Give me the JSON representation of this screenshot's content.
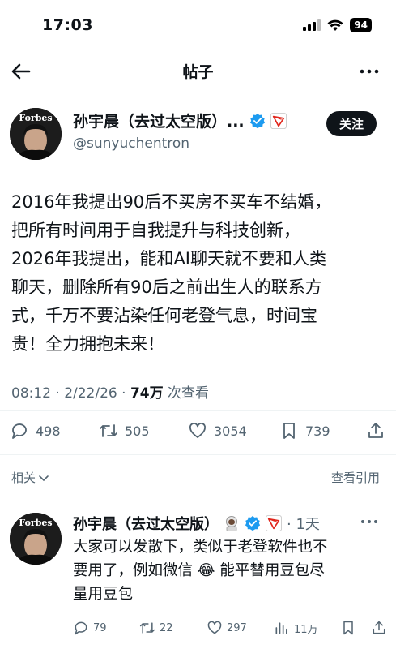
{
  "status": {
    "time": "17:03",
    "battery": "94"
  },
  "nav": {
    "title": "帖子"
  },
  "post": {
    "author_name": "孙宇晨（去过太空版）...",
    "handle": "@sunyuchentron",
    "follow_label": "关注",
    "avatar_text": "Forbes",
    "text_lines": [
      "2016年我提出90后不买房不买车不结婚，",
      "把所有时间用于自我提升与科技创新，",
      "2026年我提出，能和AI聊天就不要和人类",
      "聊天，删除所有90后之前出生人的联系方",
      "式，千万不要沾染任何老登气息，时间宝",
      "贵！全力拥抱未来！"
    ],
    "time": "08:12 · 2/22/26 · ",
    "views": "74万",
    "views_label": " 次查看",
    "replies": "498",
    "reposts": "505",
    "likes": "3054",
    "bookmarks": "739"
  },
  "related_label": "相关",
  "view_quotes_label": "查看引用",
  "reply": {
    "author_name": "孙宇晨（去过太空版）",
    "time": "· 1天",
    "avatar_text": "Forbes",
    "text_lines": [
      "大家可以发散下，类似于老登软件也不",
      "要用了，例如微信 😂 能平替用豆包尽",
      "量用豆包"
    ],
    "replies": "79",
    "reposts": "22",
    "likes": "297",
    "views": "11万"
  },
  "colors": {
    "verified": "#1d9bf0",
    "tron": "#e1261c",
    "text": "#0f1419",
    "secondary": "#536471"
  }
}
